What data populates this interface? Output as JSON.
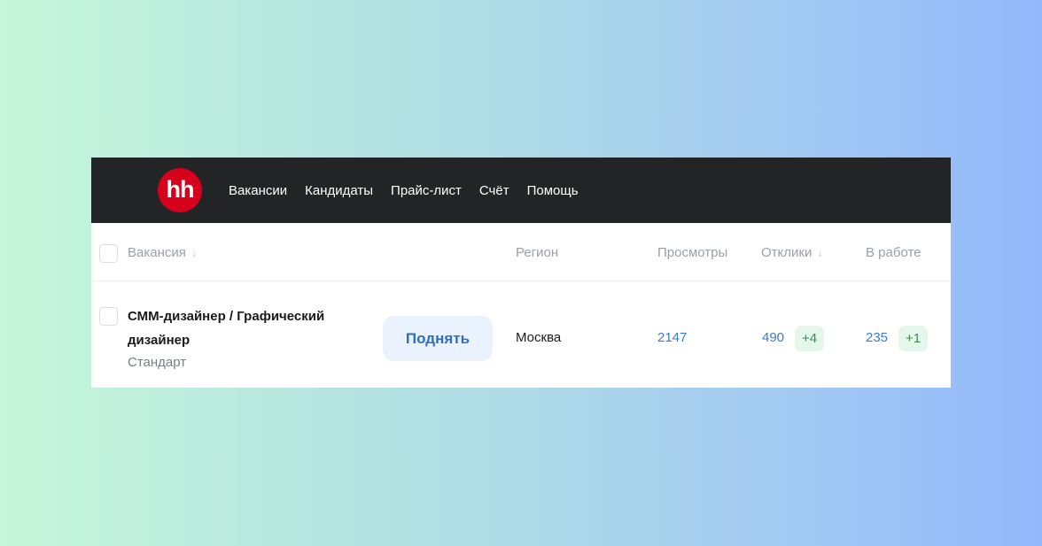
{
  "nav": {
    "logo": "hh",
    "items": [
      "Вакансии",
      "Кандидаты",
      "Прайс-лист",
      "Счёт",
      "Помощь"
    ]
  },
  "table": {
    "headers": {
      "vacancy": "Вакансия",
      "region": "Регион",
      "views": "Просмотры",
      "responses": "Отклики",
      "in_work": "В работе"
    },
    "sort_arrow": "↓",
    "rows": [
      {
        "title": "СММ-дизайнер / Графический дизайнер",
        "plan": "Стандарт",
        "action": "Поднять",
        "region": "Москва",
        "views": "2147",
        "responses": "490",
        "responses_new": "+4",
        "in_work": "235",
        "in_work_new": "+1"
      }
    ]
  }
}
